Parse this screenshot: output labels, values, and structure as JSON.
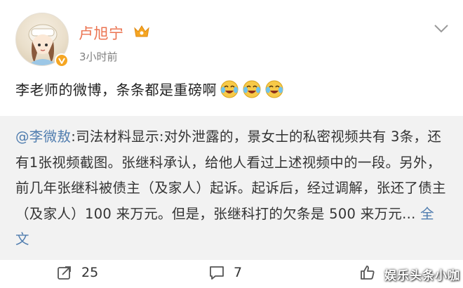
{
  "post": {
    "username": "卢旭宁",
    "timestamp": "3小时前",
    "text": "李老师的微博，条条都是重磅啊",
    "emojis": [
      "laugh-cry-icon",
      "laugh-cry-icon",
      "laugh-cry-icon"
    ]
  },
  "repost": {
    "mention": "@李微敖",
    "body": ":司法材料显示:对外泄露的，景女士的私密视频共有 3条，还有1张视频截图。张继科承认，给他人看过上述视频中的一段。另外，前几年张继科被债主（及家人）起诉。起诉后，经过调解，张还了债主（及家人）100 来万元。但是，张继科打的欠条是 500 来万元...",
    "full_text_link": "全文"
  },
  "actions": {
    "repost_count": "25",
    "comment_count": "7",
    "like_count": ""
  },
  "watermark": "娱乐头条小咖",
  "colors": {
    "username": "#eb7350",
    "link": "#507daf",
    "repost_bg": "#f2f2f2"
  }
}
